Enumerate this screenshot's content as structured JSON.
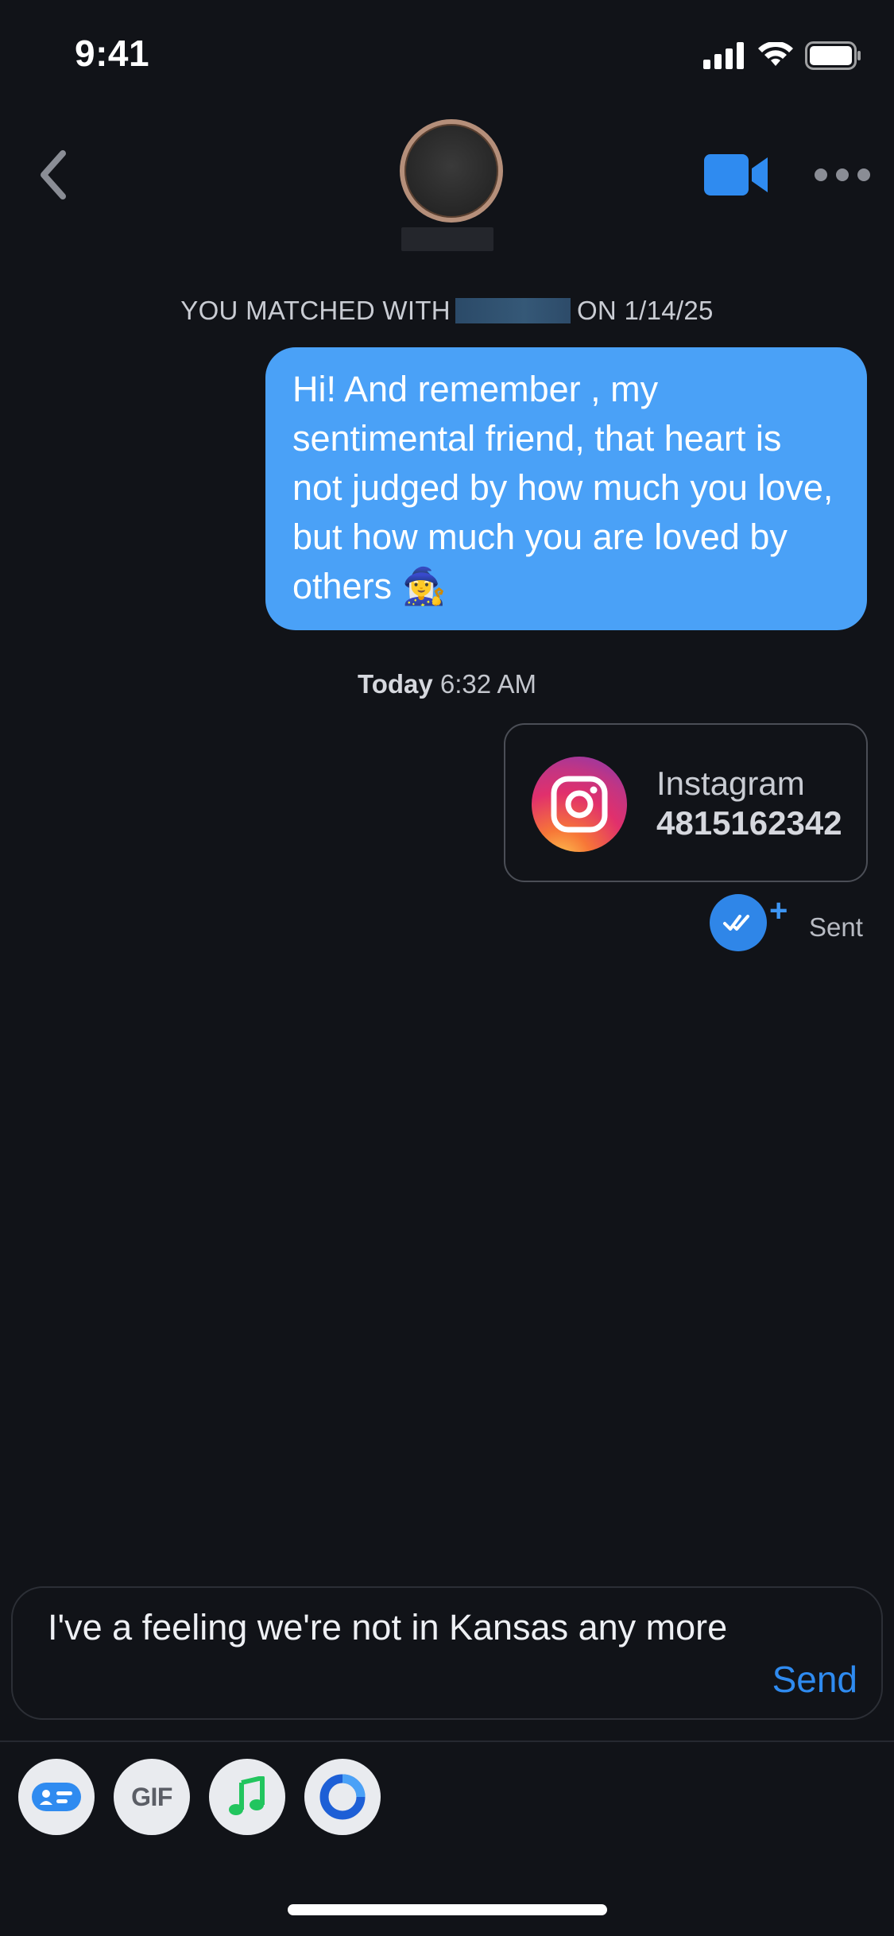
{
  "status_bar": {
    "time": "9:41",
    "icons": [
      "signal-icon",
      "wifi-icon",
      "battery-icon"
    ]
  },
  "header": {
    "back_icon": "chevron-left-icon",
    "video_icon": "video-camera-icon",
    "more_icon": "ellipsis-icon"
  },
  "conversation": {
    "matched_prefix": "YOU MATCHED WITH",
    "matched_suffix": "ON 1/14/25",
    "messages": [
      {
        "text": "Hi! And remember , my sentimental friend, that heart is not judged by how much you love, but how much you are loved by others 🧙‍♀️"
      }
    ],
    "timestamp_day": "Today",
    "timestamp_time": "6:32 AM",
    "shared_card": {
      "service": "Instagram",
      "value": "4815162342",
      "icon": "instagram-icon"
    },
    "status": "Sent"
  },
  "composer": {
    "text": "I've a feeling we're not in Kansas any more",
    "send_label": "Send"
  },
  "toolbar": {
    "gif_label": "GIF",
    "buttons": [
      "sticker-card-icon",
      "gif-icon",
      "music-note-icon",
      "ring-icon"
    ]
  },
  "colors": {
    "background": "#111318",
    "bubble": "#4aa1f7",
    "accent": "#2f8bf0",
    "card_border": "#4b4e56"
  }
}
